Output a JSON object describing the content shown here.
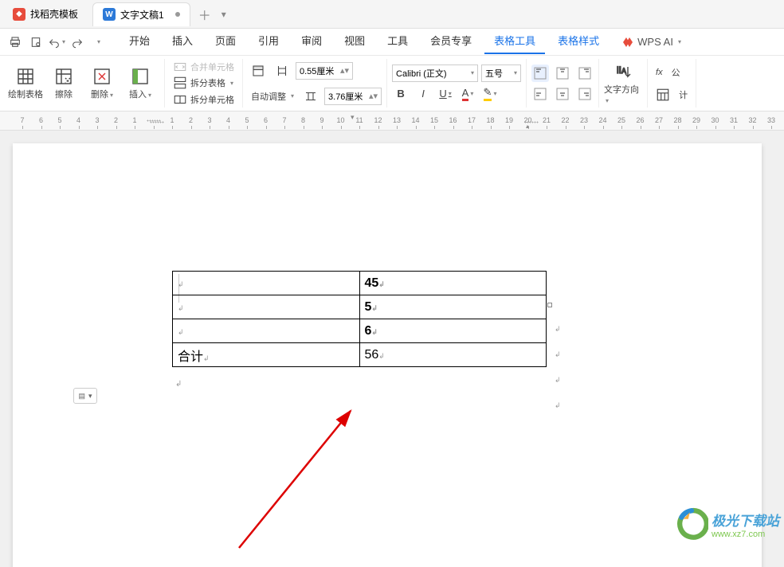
{
  "tabs": {
    "template": "找稻壳模板",
    "doc1": "文字文稿1"
  },
  "menu": {
    "items": [
      "开始",
      "插入",
      "页面",
      "引用",
      "审阅",
      "视图",
      "工具",
      "会员专享",
      "表格工具",
      "表格样式"
    ],
    "ai": "WPS AI"
  },
  "ribbon": {
    "draw_table": "绘制表格",
    "erase": "擦除",
    "delete": "删除",
    "insert": "插入",
    "merge": "合并单元格",
    "split_table": "拆分表格",
    "split_cell": "拆分单元格",
    "auto_adjust": "自动调整",
    "height_val": "0.55厘米",
    "width_val": "3.76厘米",
    "font": "Calibri (正文)",
    "font_size": "五号",
    "text_dir": "文字方向",
    "calc": "计",
    "fx": "公"
  },
  "table": {
    "rows": [
      {
        "c1": "",
        "c2": "45"
      },
      {
        "c1": "",
        "c2": "5"
      },
      {
        "c1": "",
        "c2": "6"
      },
      {
        "c1": "合计",
        "c2": "56"
      }
    ]
  },
  "watermark": {
    "title": "极光下载站",
    "url": "www.xz7.com"
  },
  "ruler_numbers": [
    7,
    6,
    5,
    4,
    3,
    2,
    1,
    "",
    1,
    2,
    3,
    4,
    5,
    6,
    7,
    8,
    9,
    10,
    11,
    12,
    13,
    14,
    15,
    16,
    17,
    18,
    19,
    20,
    21,
    22,
    23,
    24,
    25,
    26,
    27,
    28,
    29,
    30,
    31,
    32,
    33
  ]
}
